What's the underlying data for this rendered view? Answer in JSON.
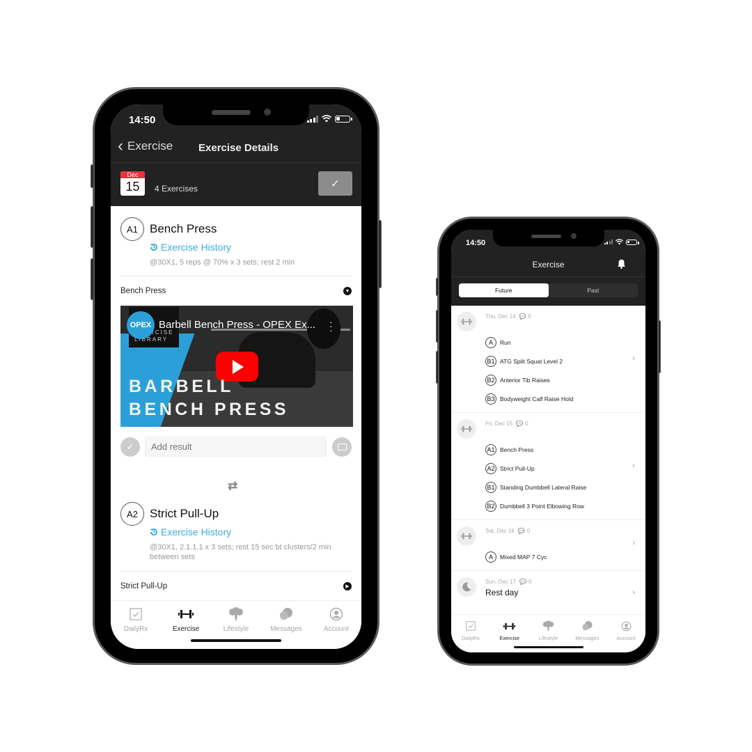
{
  "phone1": {
    "status": {
      "time": "14:50"
    },
    "nav": {
      "back_label": "Exercise",
      "title": "Exercise Details"
    },
    "date_bar": {
      "month": "Dec",
      "day": "15",
      "count": "4 Exercises",
      "done_icon": "checkmark-icon"
    },
    "exercises": [
      {
        "tag": "A1",
        "name": "Bench Press",
        "history_label": "Exercise History",
        "description": "@30X1, 5 reps @ 70% x 3 sets; rest 2 min",
        "video_row_label": "Bench Press",
        "video_row_icon": "collapse-triangle-icon",
        "video": {
          "channel_logo": "OPEX",
          "library_label": "EXERCISE LIBRARY",
          "title": "Barbell Bench Press - OPEX Ex...",
          "overlay_line1": "BARBELL",
          "overlay_line2": "BENCH PRESS"
        },
        "result_placeholder": "Add result"
      },
      {
        "tag": "A2",
        "name": "Strict Pull-Up",
        "history_label": "Exercise History",
        "description": "@30X1, 2.1.1.1 x 3 sets; rest 15 sec bt clusters/2 min between sets",
        "video_row_label": "Strict Pull-Up",
        "video_row_icon": "play-circle-icon"
      }
    ],
    "tabs": [
      {
        "label": "DailyRx",
        "icon": "checkbox-icon",
        "active": false
      },
      {
        "label": "Exercise",
        "icon": "dumbbell-icon",
        "active": true
      },
      {
        "label": "Lifestyle",
        "icon": "broccoli-icon",
        "active": false
      },
      {
        "label": "Messages",
        "icon": "chat-bubbles-icon",
        "active": false
      },
      {
        "label": "Account",
        "icon": "user-circle-icon",
        "active": false
      }
    ]
  },
  "phone2": {
    "status": {
      "time": "14:50"
    },
    "nav": {
      "title": "Exercise",
      "bell_icon": "bell-icon"
    },
    "segments": [
      {
        "label": "Future",
        "active": true
      },
      {
        "label": "Past",
        "active": false
      }
    ],
    "days": [
      {
        "date": "Thu, Dec 14",
        "comments": "0",
        "icon": "dumbbell-icon",
        "items": [
          {
            "tag": "A",
            "name": "Run"
          },
          {
            "tag": "B1",
            "name": "ATG Split Squat Level 2"
          },
          {
            "tag": "B2",
            "name": "Anterior Tib Raises"
          },
          {
            "tag": "B3",
            "name": "Bodyweight Calf Raise Hold"
          }
        ]
      },
      {
        "date": "Fri, Dec 15",
        "comments": "0",
        "icon": "dumbbell-icon",
        "items": [
          {
            "tag": "A1",
            "name": "Bench Press"
          },
          {
            "tag": "A2",
            "name": "Strict Pull-Up"
          },
          {
            "tag": "B1",
            "name": "Standing Dumbbell Lateral Raise"
          },
          {
            "tag": "B2",
            "name": "Dumbbell 3 Point Elbowing Row"
          }
        ]
      },
      {
        "date": "Sat, Dec 16",
        "comments": "0",
        "icon": "dumbbell-icon",
        "items": [
          {
            "tag": "A",
            "name": "Mixed MAP 7 Cyc"
          }
        ]
      },
      {
        "date": "Sun, Dec 17",
        "comments": "0",
        "icon": "moon-icon",
        "rest_label": "Rest day"
      }
    ],
    "tabs": [
      {
        "label": "DailyRx",
        "icon": "checkbox-icon",
        "active": false
      },
      {
        "label": "Exercise",
        "icon": "dumbbell-icon",
        "active": true
      },
      {
        "label": "Lifestyle",
        "icon": "broccoli-icon",
        "active": false
      },
      {
        "label": "Messages",
        "icon": "chat-bubbles-icon",
        "active": false
      },
      {
        "label": "Account",
        "icon": "user-circle-icon",
        "active": false
      }
    ]
  },
  "colors": {
    "accent_link": "#3aaee0",
    "header_bg": "#222222",
    "calendar_red": "#e8343c",
    "youtube_red": "#ff0000"
  }
}
